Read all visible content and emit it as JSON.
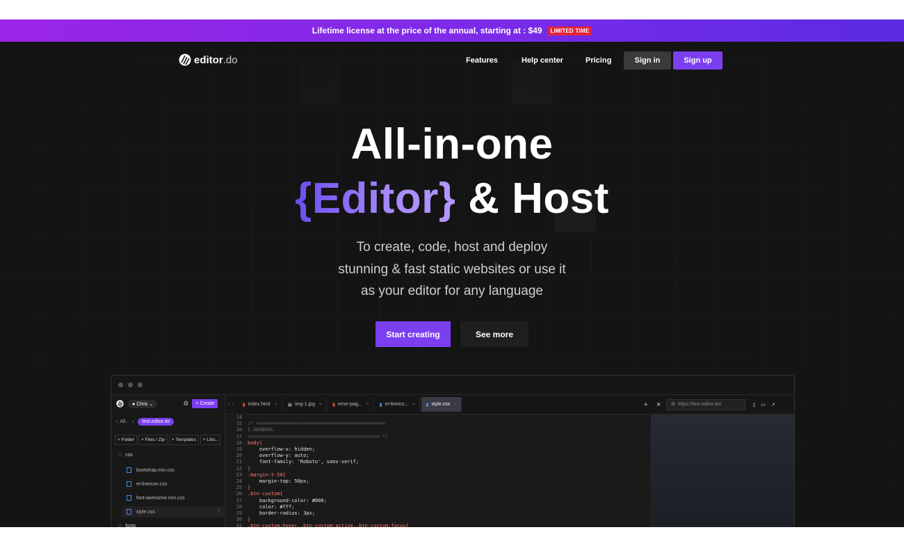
{
  "banner": {
    "text": "Lifetime license at the price of the annual, starting at : $49",
    "badge": "LIMITED TIME"
  },
  "nav": {
    "logo_main": "editor",
    "logo_suffix": ".do",
    "links": [
      "Features",
      "Help center",
      "Pricing"
    ],
    "signin": "Sign in",
    "signup": "Sign up"
  },
  "hero": {
    "line1": "All-in-one",
    "accent": "{Editor}",
    "line2_rest": "& Host",
    "sub1": "To create, code, host and deploy",
    "sub2": "stunning & fast static websites or use it",
    "sub3": "as your editor for any language",
    "cta_primary": "Start creating",
    "cta_secondary": "See more"
  },
  "editor": {
    "user": "Chris",
    "create": "+ Create",
    "crumb_back": "All..",
    "project": "test.editor.do",
    "actions": [
      "+ Folder",
      "+ Files / Zip",
      "+ Templates",
      "+ Libs.."
    ],
    "folder": "css",
    "files": [
      "bootstrap.min.css",
      "et-lineicon.css",
      "font-awesome.min.css",
      "style.css"
    ],
    "folder2": "fonts",
    "tabs": [
      "index.html",
      "img-1.jpg",
      "error-pag...",
      "et-lineico...",
      "style.css"
    ],
    "url": "https://test.editor.do/",
    "code_lines": [
      {
        "n": "14",
        "t": ""
      },
      {
        "n": "15",
        "t": "/* ============================================"
      },
      {
        "n": "16",
        "t": "I.GENERAL"
      },
      {
        "n": "17",
        "t": "============================================= */"
      },
      {
        "n": "18",
        "t": "body{"
      },
      {
        "n": "19",
        "t": "    overflow-x: hidden;"
      },
      {
        "n": "20",
        "t": "    overflow-y: auto;"
      },
      {
        "n": "21",
        "t": "    font-family: 'Roboto', sans-serif;"
      },
      {
        "n": "22",
        "t": "}"
      },
      {
        "n": "23",
        "t": ".margin-t-50{"
      },
      {
        "n": "24",
        "t": "    margin-top: 50px;"
      },
      {
        "n": "25",
        "t": "}"
      },
      {
        "n": "26",
        "t": ".btn-custom{"
      },
      {
        "n": "27",
        "t": "    background-color: #000;"
      },
      {
        "n": "28",
        "t": "    color: #fff;"
      },
      {
        "n": "29",
        "t": "    border-radius: 3px;"
      },
      {
        "n": "30",
        "t": "}"
      },
      {
        "n": "31",
        "t": ".btn-custom:hover,.btn-custom:active,.btn-custom:focus{"
      }
    ]
  },
  "colors": {
    "accent": "#7b3ff0",
    "banner_start": "#9b25e6",
    "banner_end": "#5a2be0",
    "badge": "#e0243b",
    "bg": "#141414"
  }
}
